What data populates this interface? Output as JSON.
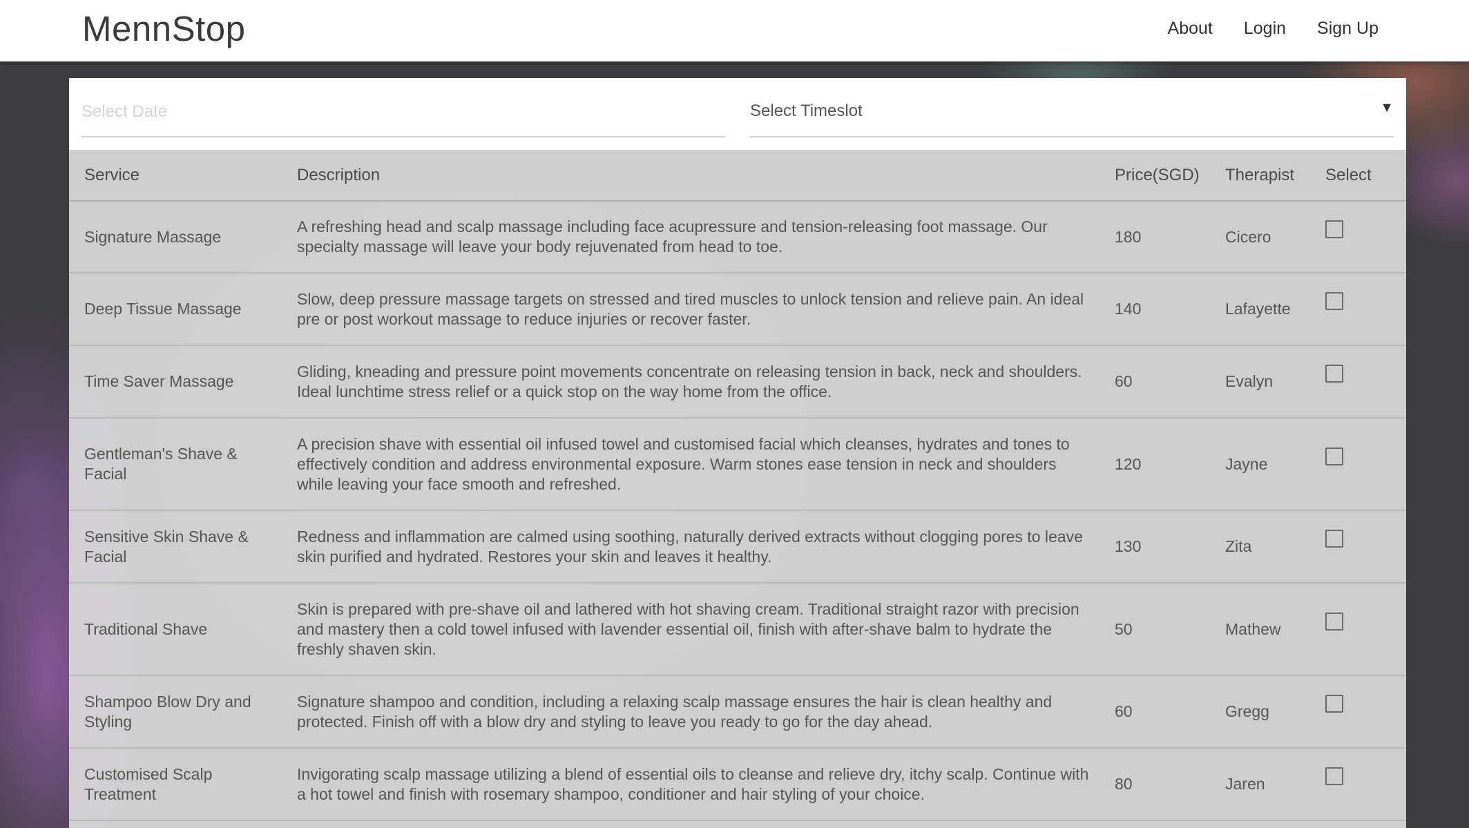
{
  "header": {
    "brand": "MennStop",
    "nav": [
      "About",
      "Login",
      "Sign Up"
    ]
  },
  "filters": {
    "date_placeholder": "Select Date",
    "date_value": "",
    "timeslot_label": "Select Timeslot",
    "timeslot_caret": "▼"
  },
  "table": {
    "columns": [
      "Service",
      "Description",
      "Price(SGD)",
      "Therapist",
      "Select"
    ],
    "rows": [
      {
        "service": "Signature Massage",
        "description": "A refreshing head and scalp massage including face acupressure and tension-releasing foot massage. Our specialty massage will leave your body rejuvenated from head to toe.",
        "price": "180",
        "therapist": "Cicero",
        "selected": false
      },
      {
        "service": "Deep Tissue Massage",
        "description": "Slow, deep pressure massage targets on stressed and tired muscles to unlock tension and relieve pain. An ideal pre or post workout massage to reduce injuries or recover faster.",
        "price": "140",
        "therapist": "Lafayette",
        "selected": false
      },
      {
        "service": "Time Saver Massage",
        "description": "Gliding, kneading and pressure point movements concentrate on releasing tension in back, neck and shoulders. Ideal lunchtime stress relief or a quick stop on the way home from the office.",
        "price": "60",
        "therapist": "Evalyn",
        "selected": false
      },
      {
        "service": "Gentleman's Shave & Facial",
        "description": "A precision shave with essential oil infused towel and customised facial which cleanses, hydrates and tones to effectively condition and address environmental exposure. Warm stones ease tension in neck and shoulders while leaving your face smooth and refreshed.",
        "price": "120",
        "therapist": "Jayne",
        "selected": false
      },
      {
        "service": "Sensitive Skin Shave & Facial",
        "description": "Redness and inflammation are calmed using soothing, naturally derived extracts without clogging pores to leave skin purified and hydrated. Restores your skin and leaves it healthy.",
        "price": "130",
        "therapist": "Zita",
        "selected": false
      },
      {
        "service": "Traditional Shave",
        "description": "Skin is prepared with pre-shave oil and lathered with hot shaving cream. Traditional straight razor with precision and mastery then a cold towel infused with lavender essential oil, finish with after-shave balm to hydrate the freshly shaven skin.",
        "price": "50",
        "therapist": "Mathew",
        "selected": false
      },
      {
        "service": "Shampoo Blow Dry and Styling",
        "description": "Signature shampoo and condition, including a relaxing scalp massage ensures the hair is clean healthy and protected. Finish off with a blow dry and styling to leave you ready to go for the day ahead.",
        "price": "60",
        "therapist": "Gregg",
        "selected": false
      },
      {
        "service": "Customised Scalp Treatment",
        "description": "Invigorating scalp massage utilizing a blend of essential oils to cleanse and relieve dry, itchy scalp. Continue with a hot towel and finish with rosemary shampoo, conditioner and hair styling of your choice.",
        "price": "80",
        "therapist": "Jaren",
        "selected": false
      }
    ]
  }
}
